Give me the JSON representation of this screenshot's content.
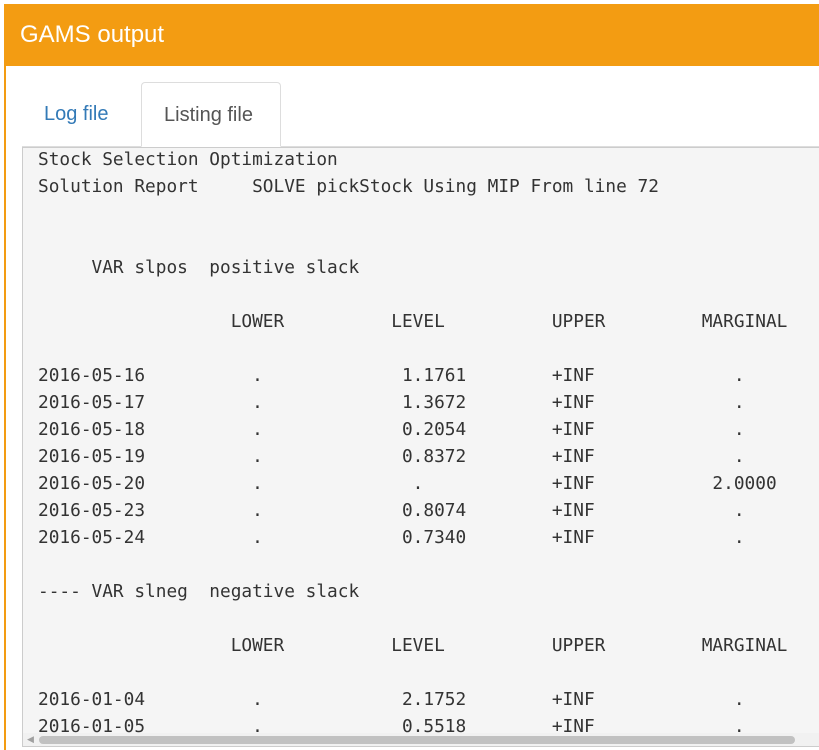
{
  "panel": {
    "title": "GAMS output",
    "accent_color": "#f39c12"
  },
  "tabs": [
    {
      "label": "Log file",
      "active": false
    },
    {
      "label": "Listing file",
      "active": true
    }
  ],
  "listing": {
    "content": "Stock Selection Optimization\nSolution Report     SOLVE pickStock Using MIP From line 72\n\n\n     VAR slpos  positive slack\n\n                  LOWER          LEVEL          UPPER         MARGINAL\n\n2016-05-16          .             1.1761        +INF             .\n2016-05-17          .             1.3672        +INF             .\n2016-05-18          .             0.2054        +INF             .\n2016-05-19          .             0.8372        +INF             .\n2016-05-20          .              .            +INF           2.0000\n2016-05-23          .             0.8074        +INF             .\n2016-05-24          .             0.7340        +INF             .\n\n---- VAR slneg  negative slack\n\n                  LOWER          LEVEL          UPPER         MARGINAL\n\n2016-01-04          .             2.1752        +INF             .\n2016-01-05          .             0.5518        +INF             ."
  },
  "icons": {
    "scroll_left": "triangle-left"
  }
}
